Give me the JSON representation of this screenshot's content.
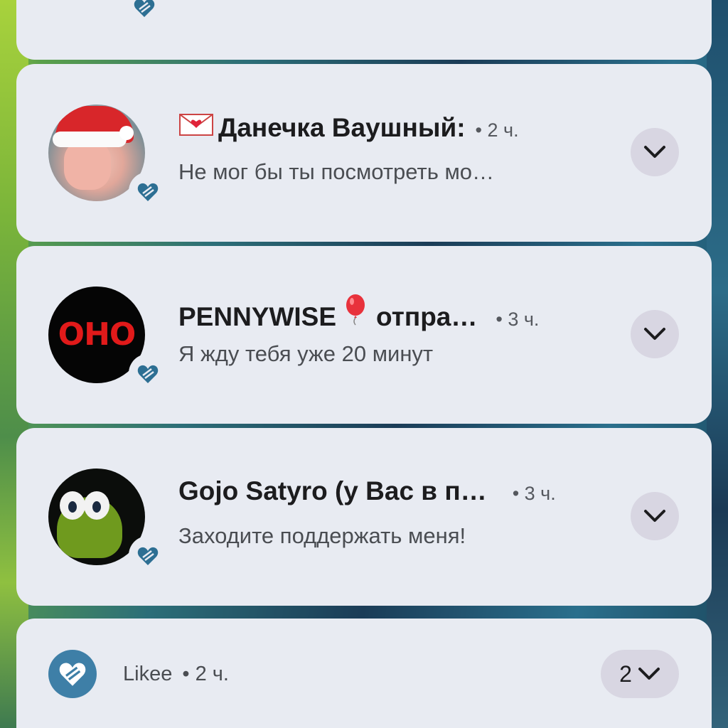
{
  "colors": {
    "card_bg": "#e8ebf2",
    "likee_blue": "#3e7fa7",
    "badge_heart": "#2d6f93",
    "expand_bg": "#d8d6e2"
  },
  "notifications": [
    {
      "avatar_icon": "santa-hat-avatar",
      "prefix_icon": "love-letter-emoji",
      "title": "Данечка Ваушный:",
      "time": "• 2 ч.",
      "message": "Не мог бы ты посмотреть мо…"
    },
    {
      "avatar_icon": "oho-avatar",
      "avatar_text": "ОНО",
      "title": "PENNYWISE",
      "balloon_icon": "red-balloon-emoji",
      "title_suffix": "отпра…",
      "time": "• 3 ч.",
      "message": "Я жду тебя уже 20 минут"
    },
    {
      "avatar_icon": "om-nom-avatar",
      "title": "Gojo Satyro (у Вас в п…",
      "time": "• 3 ч.",
      "message": "Заходите поддержать меня!"
    }
  ],
  "likee_group": {
    "app_name": "Likee",
    "time": "• 2 ч.",
    "count": "2"
  }
}
